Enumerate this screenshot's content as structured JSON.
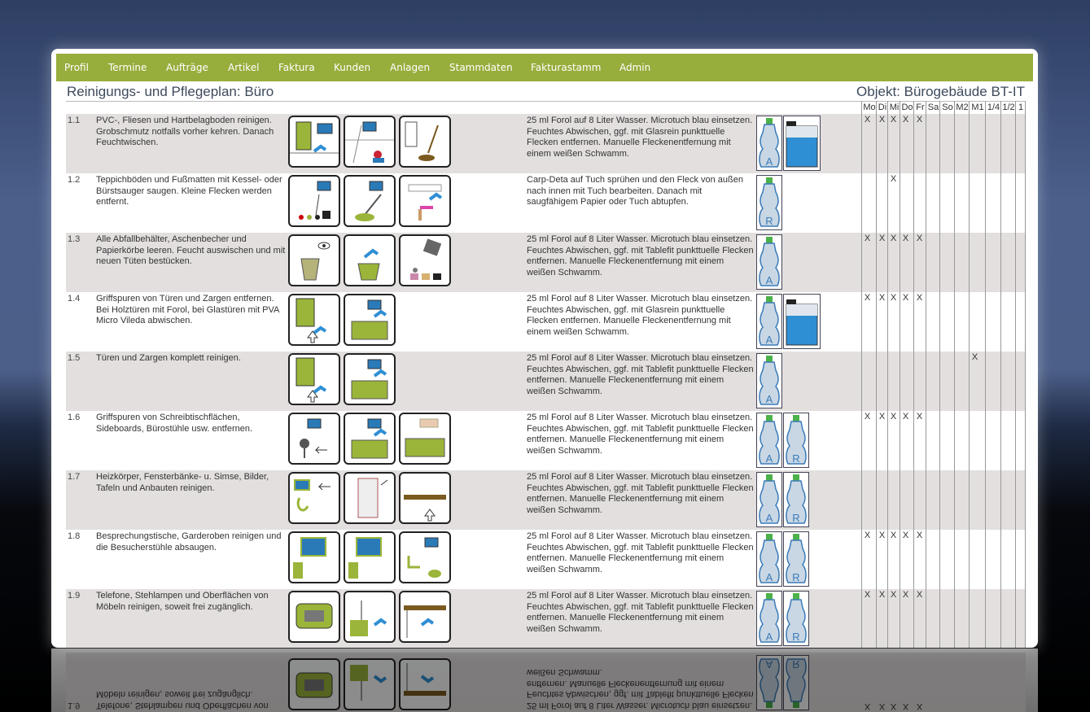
{
  "nav": {
    "items": [
      "Profil",
      "Termine",
      "Aufträge",
      "Artikel",
      "Faktura",
      "Kunden",
      "Anlagen",
      "Stammdaten",
      "Fakturastamm",
      "Admin"
    ]
  },
  "page_title": "Reinigungs- und Pflegeplan: Büro",
  "object_title": "Objekt: Bürogebäude BT-IT",
  "day_headers": [
    "Mo",
    "Di",
    "Mi",
    "Do",
    "Fr",
    "Sa",
    "So",
    "M2",
    "M1",
    "1/4",
    "1/2",
    "1"
  ],
  "rows": [
    {
      "num": "1.1",
      "desc": "PVC-, Fliesen und Hartbelagboden reinigen. Grobschmutz notfalls vorher kehren. Danach Feuchtwischen.",
      "instr": "25 ml Forol auf 8 Liter Wasser. Microtuch blau einsetzen. Feuchtes Abwischen, ggf. mit Glasrein punkttuelle Flecken entfernen. Manuelle Fleckenentfernung mit einem weißen Schwamm.",
      "agents": [
        "A"
      ],
      "canister": true,
      "marks": [
        "X",
        "X",
        "X",
        "X",
        "X",
        "",
        "",
        "",
        "",
        "",
        "",
        ""
      ]
    },
    {
      "num": "1.2",
      "desc": "Teppichböden und Fußmatten mit Kessel- oder Bürstsauger saugen. Kleine Flecken werden entfernt.",
      "instr": "Carp-Deta auf Tuch sprühen und den Fleck von außen nach innen mit Tuch bearbeiten. Danach mit saugfähigem Papier oder Tuch abtupfen.",
      "agents": [
        "R"
      ],
      "canister": false,
      "marks": [
        "",
        "",
        "X",
        "",
        "",
        "",
        "",
        "",
        "",
        "",
        "",
        ""
      ]
    },
    {
      "num": "1.3",
      "desc": "Alle Abfallbehälter, Aschenbecher und Papierkörbe leeren. Feucht auswischen und mit neuen Tüten bestücken.",
      "instr": "25 ml Forol auf 8 Liter Wasser. Microtuch blau einsetzen. Feuchtes Abwischen, ggf. mit Tablefit punkttuelle Flecken entfernen. Manuelle Fleckenentfernung mit einem weißen Schwamm.",
      "agents": [
        "A"
      ],
      "canister": false,
      "marks": [
        "X",
        "X",
        "X",
        "X",
        "X",
        "",
        "",
        "",
        "",
        "",
        "",
        ""
      ]
    },
    {
      "num": "1.4",
      "desc": "Griffspuren von Türen und Zargen entfernen. Bei Holztüren mit Forol, bei Glastüren mit PVA Micro Vileda abwischen.",
      "instr": "25 ml Forol auf 8 Liter Wasser. Microtuch blau einsetzen. Feuchtes Abwischen, ggf. mit Glasrein punkttuelle Flecken entfernen. Manuelle Fleckenentfernung mit einem weißen Schwamm.",
      "agents": [
        "A"
      ],
      "canister": true,
      "marks": [
        "X",
        "X",
        "X",
        "X",
        "X",
        "",
        "",
        "",
        "",
        "",
        "",
        ""
      ]
    },
    {
      "num": "1.5",
      "desc": "Türen und Zargen komplett reinigen.",
      "instr": "25 ml Forol auf 8 Liter Wasser. Microtuch blau einsetzen. Feuchtes Abwischen, ggf. mit Tablefit punkttuelle Flecken entfernen. Manuelle Fleckenentfernung mit einem weißen Schwamm.",
      "agents": [
        "A"
      ],
      "canister": false,
      "marks": [
        "",
        "",
        "",
        "",
        "",
        "",
        "",
        "",
        "X",
        "",
        "",
        ""
      ]
    },
    {
      "num": "1.6",
      "desc": "Griffspuren von Schreibtischflächen, Sideboards, Bürostühle usw. entfernen.",
      "instr": "25 ml Forol auf 8 Liter Wasser. Microtuch blau einsetzen. Feuchtes Abwischen, ggf. mit Tablefit punkttuelle Flecken entfernen. Manuelle Fleckenentfernung mit einem weißen Schwamm.",
      "agents": [
        "A",
        "R"
      ],
      "canister": false,
      "marks": [
        "X",
        "X",
        "X",
        "X",
        "X",
        "",
        "",
        "",
        "",
        "",
        "",
        ""
      ]
    },
    {
      "num": "1.7",
      "desc": "Heizkörper, Fensterbänke- u. Simse, Bilder, Tafeln und Anbauten reinigen.",
      "instr": "25 ml Forol auf 8 Liter Wasser. Microtuch blau einsetzen. Feuchtes Abwischen, ggf. mit Tablefit punkttuelle Flecken entfernen. Manuelle Fleckenentfernung mit einem weißen Schwamm.",
      "agents": [
        "A",
        "R"
      ],
      "canister": false,
      "marks": [
        "",
        "",
        "",
        "",
        "",
        "",
        "",
        "",
        "",
        "",
        "",
        ""
      ]
    },
    {
      "num": "1.8",
      "desc": "Besprechungstische, Garderoben reinigen und die Besucherstühle absaugen.",
      "instr": "25 ml Forol auf 8 Liter Wasser. Microtuch blau einsetzen. Feuchtes Abwischen, ggf. mit Tablefit punkttuelle Flecken entfernen. Manuelle Fleckenentfernung mit einem weißen Schwamm.",
      "agents": [
        "A",
        "R"
      ],
      "canister": false,
      "marks": [
        "X",
        "X",
        "X",
        "X",
        "X",
        "",
        "",
        "",
        "",
        "",
        "",
        ""
      ]
    },
    {
      "num": "1.9",
      "desc": "Telefone, Stehlampen und Oberflächen von Möbeln reinigen, soweit frei zugänglich.",
      "instr": "25 ml Forol auf 8 Liter Wasser. Microtuch blau einsetzen. Feuchtes Abwischen, ggf. mit Tablefit punkttuelle Flecken entfernen. Manuelle Fleckenentfernung mit einem weißen Schwamm.",
      "agents": [
        "A",
        "R"
      ],
      "canister": false,
      "marks": [
        "X",
        "X",
        "X",
        "X",
        "X",
        "",
        "",
        "",
        "",
        "",
        "",
        ""
      ]
    }
  ]
}
